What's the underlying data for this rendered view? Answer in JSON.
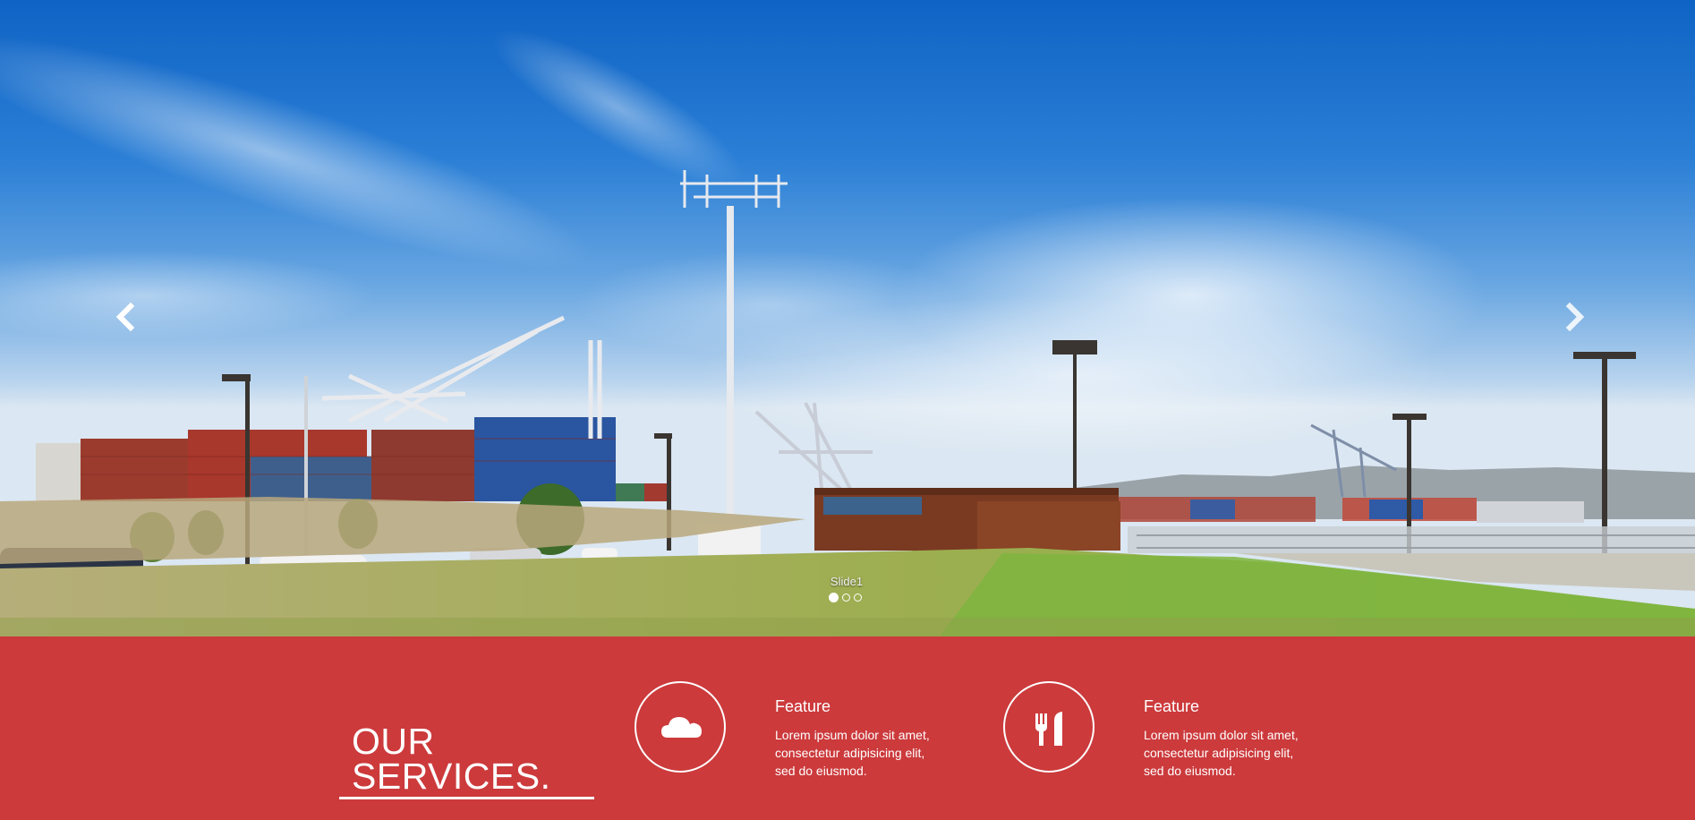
{
  "carousel": {
    "caption": "Slide1",
    "indicators": [
      {
        "active": true
      },
      {
        "active": false
      },
      {
        "active": false
      }
    ],
    "prev_icon": "chevron-left-icon",
    "next_icon": "chevron-right-icon"
  },
  "services": {
    "title_line1": "OUR",
    "title_line2": "SERVICES.",
    "background_color": "#cc3a3c",
    "features": [
      {
        "icon": "cloud-icon",
        "title": "Feature",
        "text_lines": [
          "Lorem ipsum dolor sit amet,",
          "consectetur adipisicing elit,",
          "sed do eiusmod."
        ]
      },
      {
        "icon": "cutlery-icon",
        "title": "Feature",
        "text_lines": [
          "Lorem ipsum dolor sit amet,",
          "consectetur adipisicing elit,",
          "sed do eiusmod."
        ]
      }
    ]
  }
}
